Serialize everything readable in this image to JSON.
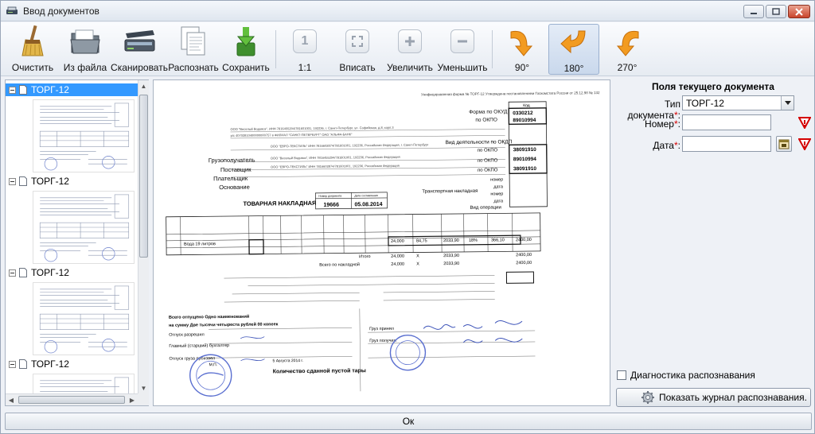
{
  "window": {
    "title": "Ввод документов"
  },
  "toolbar": {
    "clear": "Очистить",
    "from_file": "Из файла",
    "scan": "Сканировать",
    "recognize": "Распознать",
    "save": "Сохранить",
    "zoom_1_1": "1:1",
    "fit": "Вписать",
    "zoom_in": "Увеличить",
    "zoom_out": "Уменьшить",
    "rotate_90": "90°",
    "rotate_180": "180°",
    "rotate_270": "270°"
  },
  "documents": [
    {
      "name": "ТОРГ-12",
      "selected": true
    },
    {
      "name": "ТОРГ-12",
      "selected": false
    },
    {
      "name": "ТОРГ-12",
      "selected": false
    },
    {
      "name": "ТОРГ-12",
      "selected": false
    }
  ],
  "fields_panel": {
    "title": "Поля текущего документа",
    "doc_type_label": "Тип документа",
    "doc_type_value": "ТОРГ-12",
    "number_label": "Номер",
    "date_label": "Дата",
    "required_mark": "*",
    "colon": ":",
    "diagnostics_label": "Диагностика распознавания",
    "show_log_button": "Показать журнал распознавания."
  },
  "scan": {
    "form_header": "Унифицированная форма № ТОРГ-12 Утверждена постановлением Госкомстата России от 25.12.98 № 132",
    "okud_label": "Форма по ОКУД",
    "okpo_label": "по ОКПО",
    "code_header": "Код",
    "okud_code": "0330212",
    "okpo_code": "89010994",
    "okpo_code2": "38091910",
    "okpo_code3": "89010994",
    "okpo_code4": "38091910",
    "activity_label": "Вид деятельности по ОКДП",
    "consignee_label": "Грузополучатель",
    "supplier_label": "Поставщик",
    "payer_label": "Плательщик",
    "basis_label": "Основание",
    "number_label": "номер",
    "date_label": "дата",
    "transport_label": "Транспортная накладная",
    "operation_label": "Вид операции",
    "doc_title": "ТОВАРНАЯ НАКЛАДНАЯ",
    "doc_number_header": "Номер документа",
    "doc_date_header": "Дата составления",
    "doc_number": "19666",
    "doc_date": "05.08.2014",
    "item_name": "Вода 19 литров",
    "qty": "24,000",
    "price": "84,75",
    "sum_no_vat": "2033,90",
    "vat_rate": "18%",
    "vat_sum": "366,10",
    "total": "2400,00",
    "total_label": "Итого",
    "grand_total_label": "Всего по накладной",
    "x_mark": "X",
    "amount_words": "на сумму Две тысячи четыреста рублей 00 копеек",
    "released_label": "Отпуск разрешил",
    "accountant_label": "Главный (старший) бухгалтер",
    "shipped_label": "Отпуск груза произвел",
    "received_label": "Груз принял",
    "received_by_label": "Груз получил",
    "empty_tare_label": "Количество сданной пустой тары",
    "stamp_label": "М.П.",
    "date_signed": "5 Августа 2014 г."
  }
}
